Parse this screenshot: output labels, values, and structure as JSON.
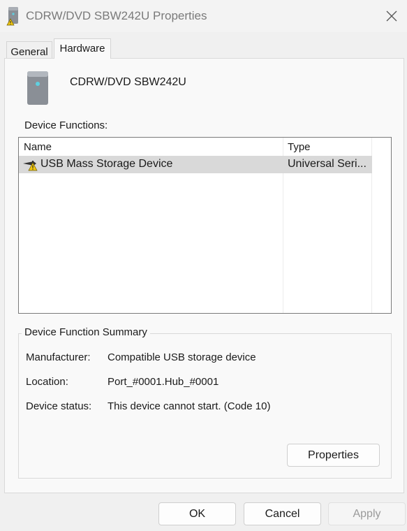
{
  "window": {
    "title": "CDRW/DVD SBW242U Properties",
    "close_icon": "close-icon"
  },
  "tabs": [
    {
      "label": "General",
      "selected": false
    },
    {
      "label": "Hardware",
      "selected": true
    }
  ],
  "hardware": {
    "device_icon": "drive-icon",
    "device_name": "CDRW/DVD SBW242U",
    "functions_label": "Device Functions:",
    "columns": [
      "Name",
      "Type"
    ],
    "rows": [
      {
        "icon": "usb-warning-icon",
        "name": "USB Mass Storage Device",
        "type": "Universal Seri...",
        "selected": true
      }
    ]
  },
  "summary": {
    "title": "Device Function Summary",
    "manufacturer_label": "Manufacturer:",
    "manufacturer_value": "Compatible USB storage device",
    "location_label": "Location:",
    "location_value": "Port_#0001.Hub_#0001",
    "status_label": "Device status:",
    "status_value": "This device cannot start. (Code 10)",
    "properties_button": "Properties"
  },
  "footer": {
    "ok_label": "OK",
    "cancel_label": "Cancel",
    "apply_label": "Apply",
    "apply_enabled": false
  },
  "colors": {
    "selection": "#d9d9d9",
    "warning": "#f2c811",
    "accent_led": "#5fd0e0"
  }
}
